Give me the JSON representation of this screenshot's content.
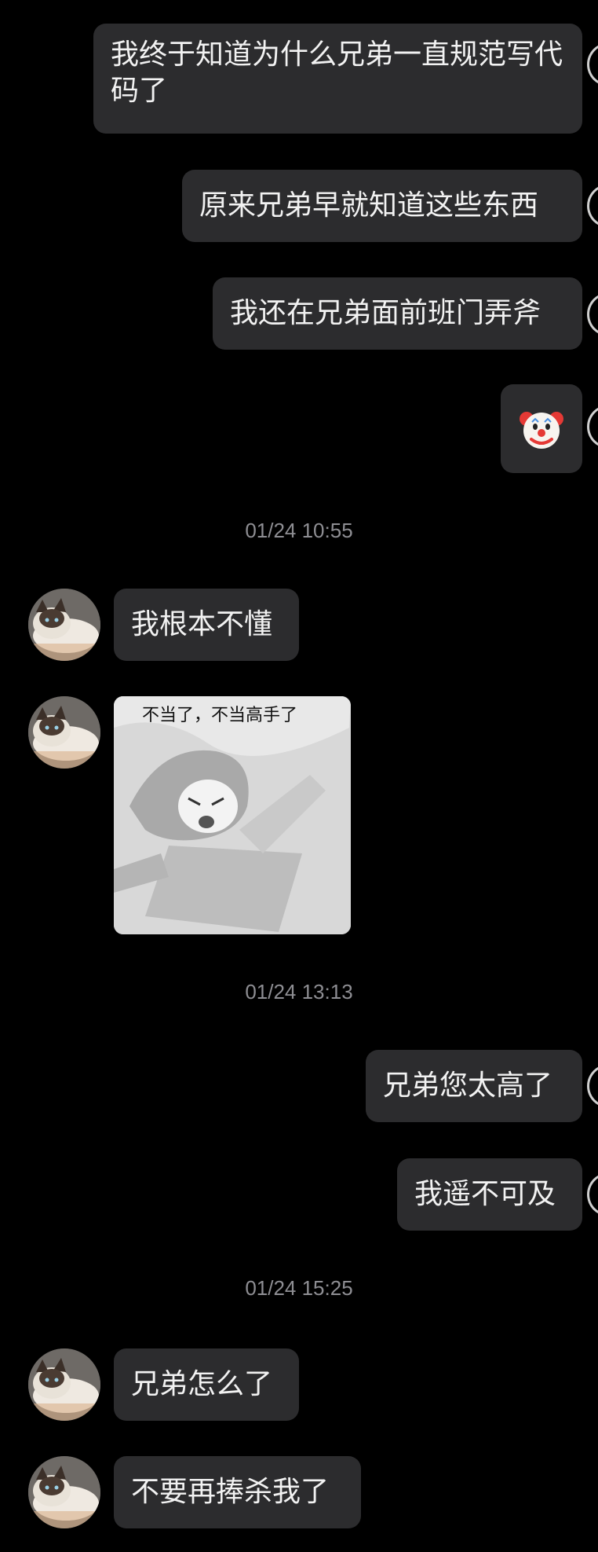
{
  "messages_sent_1": [
    {
      "text": "我终于知道为什么兄弟一直规范写代码了"
    },
    {
      "text": "原来兄弟早就知道这些东西"
    },
    {
      "text": "我还在兄弟面前班门弄斧"
    },
    {
      "emoji": "🤡"
    }
  ],
  "timestamps": [
    "01/24 10:55",
    "01/24 13:13",
    "01/24 15:25"
  ],
  "received_1": {
    "text": "我根本不懂",
    "sticker_caption": "不当了，不当高手了"
  },
  "sent_2": [
    "兄弟您太高了",
    "我遥不可及"
  ],
  "received_2": [
    "兄弟怎么了",
    "不要再捧杀我了"
  ],
  "colors": {
    "background": "#000000",
    "bubble": "#2c2c2e",
    "timestamp": "#8e8e93",
    "text": "#f2f2f2"
  },
  "icons": {
    "avatar": "cat-avatar-icon",
    "clown": "clown-face-emoji"
  }
}
